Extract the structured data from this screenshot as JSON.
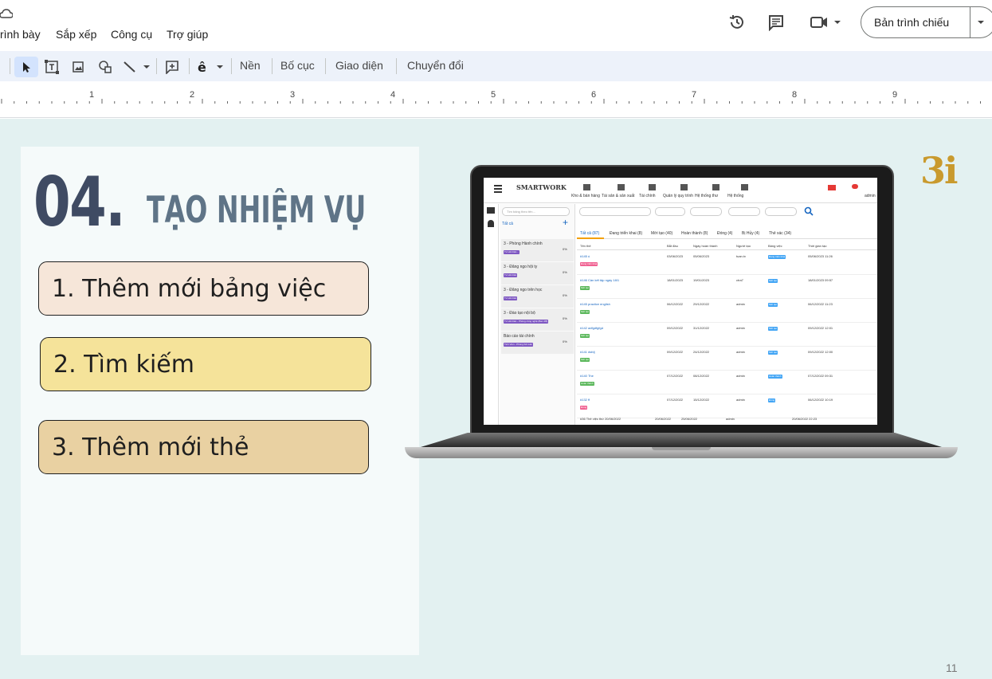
{
  "menu": {
    "items": [
      "rình bày",
      "Sắp xếp",
      "Công cụ",
      "Trợ giúp"
    ]
  },
  "header_actions": {
    "slideshow_label": "Bản trình chiếu"
  },
  "toolbar": {
    "background_label": "Nền",
    "layout_label": "Bố cục",
    "theme_label": "Giao diện",
    "transition_label": "Chuyển đổi"
  },
  "ruler": {
    "ticks": [
      "1",
      "2",
      "3",
      "4",
      "5",
      "6",
      "7",
      "8",
      "9"
    ]
  },
  "slide": {
    "number": "04.",
    "title": "TẠO NHIỆM VỤ",
    "steps": [
      "1. Thêm mới bảng việc",
      "2. Tìm kiếm",
      "3. Thêm mới thẻ"
    ],
    "logo": "3i",
    "page_number": "11",
    "colors": {
      "step1": "#f6e6d9",
      "step2": "#f5e39a",
      "step3": "#e9d1a2",
      "title_number": "#3f4b63",
      "title_text": "#5f7487"
    }
  },
  "laptop_screen": {
    "brand": "SMARTWORK",
    "nav": [
      "Kho & bán hàng",
      "Tài sản & sản xuất",
      "Tài chính",
      "Quản lý quy trình",
      "Hệ thống thư",
      "Hệ thống"
    ],
    "user": "admin",
    "sidebar_search": "Tìm bảng theo tên...",
    "sidebar_header": "Tất cả",
    "boards": [
      {
        "name": "3 - Phòng Hành chính",
        "tag": "Tư vấn bán...",
        "pct": "0%"
      },
      {
        "name": "3 - Đăng ngo hội ty",
        "tag": "Tư vấn bán",
        "pct": "0%"
      },
      {
        "name": "3 - Đăng ngo trên học",
        "tag": "Tư vấn bán",
        "pct": "0%"
      },
      {
        "name": "3 - Đào tạo nội bộ",
        "tag": "Tư vấn bán - Phòng công nghệ (Ban 2B)",
        "pct": "0%"
      },
      {
        "name": "Báo cáo tài chính",
        "tag": "Tinh Viên - Phòng Kế toán",
        "pct": "0%"
      }
    ],
    "tabs": [
      "Tất cả (87)",
      "Đang triển khai (8)",
      "Mới tạo (40)",
      "Hoàn thành (8)",
      "Đóng (4)",
      "Bị Hủy (4)",
      "Thẻ xác (34)"
    ],
    "columns": [
      "Tên thẻ",
      "Bắt đầu",
      "Ngày hoàn thành",
      "Người tạo",
      "Bảng việc",
      "Thời gian tạo"
    ],
    "rows": [
      {
        "name": "#145 ú",
        "start": "03/06/2023",
        "end": "05/06/2023",
        "creator": "tuan.tv",
        "date": "05/06/2023 11:26",
        "tag": "Đang triển khai",
        "tag_color": "#f06292"
      },
      {
        "name": "#146 Cần kết tập ngày 18/1",
        "start": "18/01/2023",
        "end": "19/01/2023",
        "creator": "ctra7",
        "date": "18/01/2023 09:57",
        "tag": "Mới tạo",
        "tag_color": "#5cb85c"
      },
      {
        "name": "#145 practice english",
        "start": "06/12/2022",
        "end": "29/12/2022",
        "creator": "admin",
        "date": "06/12/2022 11:23",
        "tag": "Mới tạo",
        "tag_color": "#5cb85c"
      },
      {
        "name": "#142 adfgdfgfgd",
        "start": "09/12/2022",
        "end": "31/12/2022",
        "creator": "admin",
        "date": "09/12/2022 12:01",
        "tag": "Mới tạo",
        "tag_color": "#5cb85c"
      },
      {
        "name": "#141 dsfdj",
        "start": "09/12/2022",
        "end": "24/12/2022",
        "creator": "admin",
        "date": "09/12/2022 12:00",
        "tag": "Mới tạo",
        "tag_color": "#5cb85c"
      },
      {
        "name": "#140 The",
        "start": "07/12/2022",
        "end": "08/12/2022",
        "creator": "admin",
        "date": "07/12/2022 09:31",
        "tag": "Hoàn thành",
        "tag_color": "#5cb85c"
      },
      {
        "name": "#132 ff",
        "start": "07/12/2022",
        "end": "15/12/2022",
        "creator": "admin",
        "date": "06/12/2022 10:19",
        "tag": "Đóng",
        "tag_color": "#f06292"
      }
    ],
    "footer_row": {
      "name": "#36 Thẻ việc thứ 20/06/2022",
      "start": "20/06/2022",
      "end": "25/06/2022",
      "creator": "admin",
      "date": "20/06/2022 22:23"
    }
  }
}
